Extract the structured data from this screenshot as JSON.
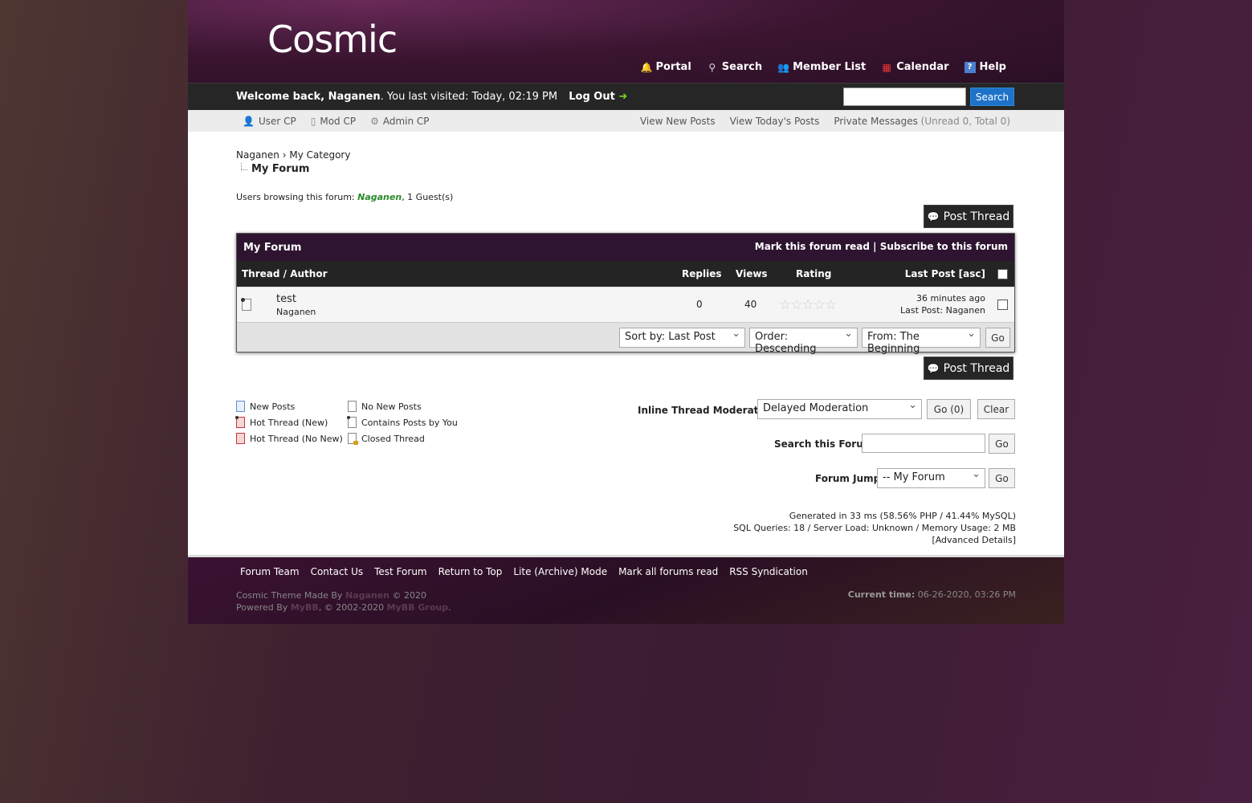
{
  "header": {
    "logo": "Cosmic",
    "menu": [
      {
        "label": "Portal",
        "icon": "bell-icon"
      },
      {
        "label": "Search",
        "icon": "magnifier-icon"
      },
      {
        "label": "Member List",
        "icon": "members-icon"
      },
      {
        "label": "Calendar",
        "icon": "calendar-icon"
      },
      {
        "label": "Help",
        "icon": "help-icon"
      }
    ]
  },
  "welcome": {
    "prefix": "Welcome back, ",
    "username": "Naganen",
    "visited": ". You last visited: Today, 02:19 PM",
    "logout": "Log Out",
    "search_button": "Search"
  },
  "panel": {
    "user_cp": "User CP",
    "mod_cp": "Mod CP",
    "admin_cp": "Admin CP",
    "view_new": "View New Posts",
    "view_today": "View Today's Posts",
    "pm": "Private Messages",
    "pm_counts": "(Unread 0, Total 0)"
  },
  "breadcrumb": {
    "root": "Naganen",
    "sep": "›",
    "category": "My Category",
    "current": "My Forum"
  },
  "users_browsing": {
    "label": "Users browsing this forum: ",
    "user": "Naganen",
    "guests": ", 1 Guest(s)"
  },
  "post_thread": "Post Thread",
  "forum": {
    "title": "My Forum",
    "mark_read": "Mark this forum read",
    "divider": "|",
    "subscribe": "Subscribe to this forum",
    "columns": {
      "thread": "Thread / Author",
      "replies": "Replies",
      "views": "Views",
      "rating": "Rating",
      "last_post": "Last Post [asc]"
    },
    "threads": [
      {
        "title": "test",
        "author": "Naganen",
        "replies": "0",
        "views": "40",
        "rating": 0,
        "last_time": "36 minutes ago",
        "last_by": "Last Post: Naganen"
      }
    ],
    "sort": {
      "sort_by": "Sort by: Last Post",
      "order": "Order: Descending",
      "from": "From: The Beginning",
      "go": "Go"
    }
  },
  "legend": {
    "col1": [
      "New Posts",
      "Hot Thread (New)",
      "Hot Thread (No New)"
    ],
    "col2": [
      "No New Posts",
      "Contains Posts by You",
      "Closed Thread"
    ]
  },
  "moderation": {
    "label": "Inline Thread Moderation:",
    "selected": "Delayed Moderation",
    "go": "Go (0)",
    "clear": "Clear"
  },
  "search_forum": {
    "label": "Search this Forum:",
    "go": "Go"
  },
  "forum_jump": {
    "label": "Forum Jump:",
    "selected": "-- My Forum",
    "go": "Go"
  },
  "stats": {
    "line1": "Generated in 33 ms (58.56% PHP / 41.44% MySQL)",
    "line2": "SQL Queries: 18 / Server Load: Unknown / Memory Usage: 2 MB",
    "line3": "[Advanced Details]"
  },
  "footer": {
    "links": [
      "Forum Team",
      "Contact Us",
      "Test Forum",
      "Return to Top",
      "Lite (Archive) Mode",
      "Mark all forums read",
      "RSS Syndication"
    ],
    "copy1_pre": "Cosmic Theme Made By ",
    "copy1_name": "Naganen",
    "copy1_post": " © 2020",
    "copy2_pre": "Powered By ",
    "copy2_mybb": "MyBB",
    "copy2_mid": ", © 2002-2020 ",
    "copy2_group": "MyBB Group",
    "copy2_post": ".",
    "time_label": "Current time:",
    "time_value": " 06-26-2020, 03:26 PM"
  }
}
